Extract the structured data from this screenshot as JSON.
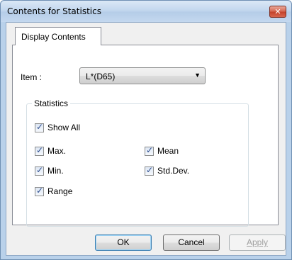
{
  "window": {
    "title": "Contents for Statistics",
    "close_glyph": "✕"
  },
  "tabs": [
    {
      "label": "Display Contents",
      "active": true
    }
  ],
  "item": {
    "label": "Item :",
    "value": "L*(D65)",
    "arrow_glyph": "▼"
  },
  "statistics": {
    "legend": "Statistics",
    "show_all": {
      "label": "Show All",
      "checked": true
    },
    "options": [
      {
        "label": "Max.",
        "checked": true
      },
      {
        "label": "Min.",
        "checked": true
      },
      {
        "label": "Range",
        "checked": true
      },
      {
        "label": "Mean",
        "checked": true
      },
      {
        "label": "Std.Dev.",
        "checked": true
      }
    ]
  },
  "buttons": {
    "ok": "OK",
    "cancel": "Cancel",
    "apply": "Apply"
  },
  "check_glyph": "✓",
  "colors": {
    "title_bar": "#c3d7ee",
    "close_button": "#c4432c",
    "check_mark": "#2b4b8c",
    "dialog_face": "#f0f0f0"
  }
}
